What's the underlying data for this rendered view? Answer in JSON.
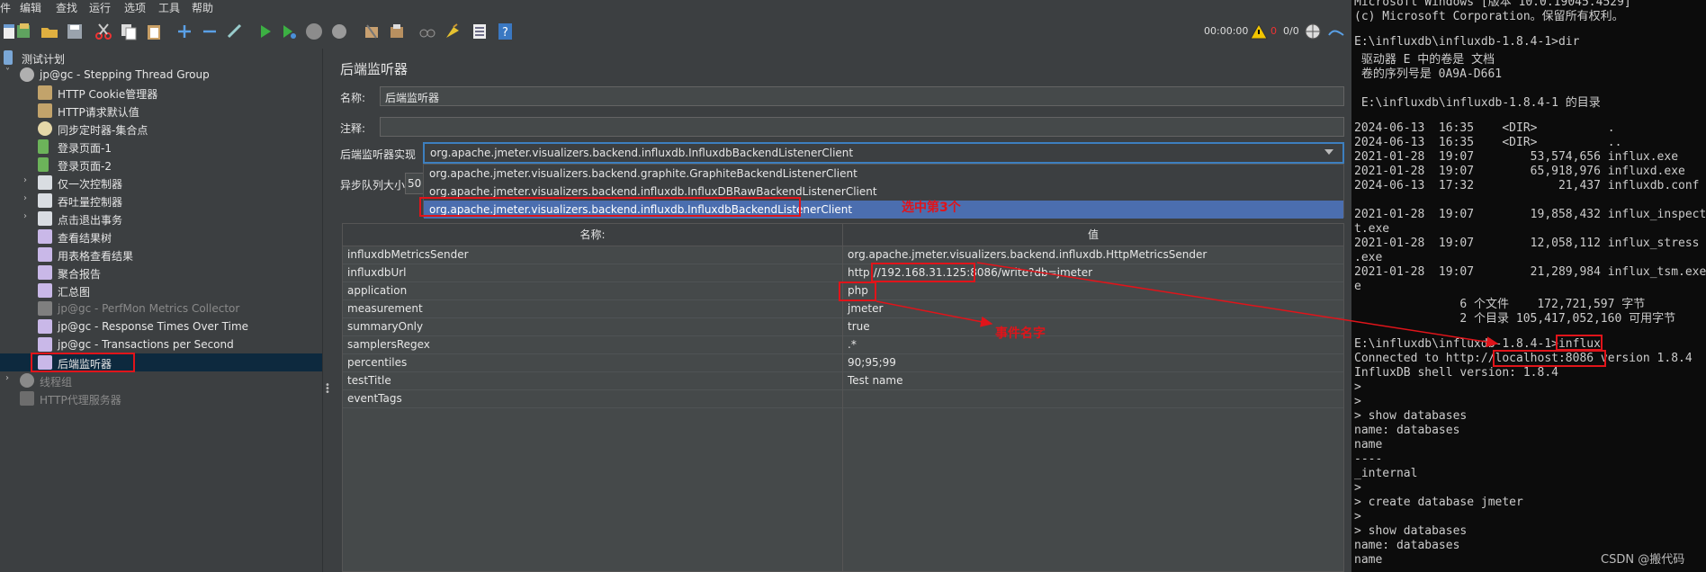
{
  "menu": [
    "件",
    "编辑",
    "查找",
    "运行",
    "选项",
    "工具",
    "帮助"
  ],
  "toolbar": {
    "timer": "00:00:00",
    "warning_count": "0",
    "threads": "0/0"
  },
  "tree": {
    "items": [
      {
        "label": "测试计划",
        "icon": "test-plan-icon"
      },
      {
        "label": "jp@gc - Stepping Thread Group",
        "icon": "gear-icon",
        "expander": "˅"
      },
      {
        "label": "HTTP Cookie管理器",
        "icon": "tools-icon"
      },
      {
        "label": "HTTP请求默认值",
        "icon": "tools-icon"
      },
      {
        "label": "同步定时器-集合点",
        "icon": "timer-icon"
      },
      {
        "label": "登录页面-1",
        "icon": "pipette-icon"
      },
      {
        "label": "登录页面-2",
        "icon": "pipette-icon"
      },
      {
        "label": "仅一次控制器",
        "icon": "controller-icon",
        "expander": "›"
      },
      {
        "label": "吞吐量控制器",
        "icon": "controller-icon",
        "expander": "›"
      },
      {
        "label": "点击退出事务",
        "icon": "controller-icon",
        "expander": "›"
      },
      {
        "label": "查看结果树",
        "icon": "listener-icon"
      },
      {
        "label": "用表格查看结果",
        "icon": "listener-icon"
      },
      {
        "label": "聚合报告",
        "icon": "listener-icon"
      },
      {
        "label": "汇总图",
        "icon": "listener-icon"
      },
      {
        "label": "jp@gc - PerfMon Metrics Collector",
        "icon": "listener-icon",
        "dim": true
      },
      {
        "label": "jp@gc - Response Times Over Time",
        "icon": "listener-icon"
      },
      {
        "label": "jp@gc - Transactions per Second",
        "icon": "listener-icon"
      },
      {
        "label": "后端监听器",
        "icon": "listener-icon",
        "selected": true
      },
      {
        "label": "线程组",
        "icon": "gear-icon",
        "dim": true,
        "expander": "›"
      },
      {
        "label": "HTTP代理服务器",
        "icon": "proxy-icon",
        "dim": true
      }
    ]
  },
  "panel": {
    "title": "后端监听器",
    "name_label": "名称:",
    "name_value": "后端监听器",
    "comment_label": "注释:",
    "comment_value": "",
    "impl_label": "后端监听器实现",
    "impl_value": "org.apache.jmeter.visualizers.backend.influxdb.InfluxdbBackendListenerClient",
    "options": [
      "org.apache.jmeter.visualizers.backend.graphite.GraphiteBackendListenerClient",
      "org.apache.jmeter.visualizers.backend.influxdb.InfluxDBRawBackendListenerClient",
      "org.apache.jmeter.visualizers.backend.influxdb.InfluxdbBackendListenerClient"
    ],
    "queue_label": "异步队列大小",
    "queue_value": "50",
    "table": {
      "col_name": "名称:",
      "col_value": "值",
      "rows": [
        {
          "name": "influxdbMetricsSender",
          "value": "org.apache.jmeter.visualizers.backend.influxdb.HttpMetricsSender"
        },
        {
          "name": "influxdbUrl",
          "value": "http://192.168.31.125:8086/write?db=jmeter"
        },
        {
          "name": "application",
          "value": "php"
        },
        {
          "name": "measurement",
          "value": "jmeter"
        },
        {
          "name": "summaryOnly",
          "value": "true"
        },
        {
          "name": "samplersRegex",
          "value": ".*"
        },
        {
          "name": "percentiles",
          "value": "90;95;99"
        },
        {
          "name": "testTitle",
          "value": "Test name"
        },
        {
          "name": "eventTags",
          "value": ""
        }
      ]
    }
  },
  "annotations": {
    "select_third": "选中第3个",
    "event_name": "事件名字"
  },
  "console": {
    "lines": [
      "Microsoft Windows [版本 10.0.19045.4529]",
      "(c) Microsoft Corporation。保留所有权利。",
      "",
      "E:\\influxdb\\influxdb-1.8.4-1>dir",
      " 驱动器 E 中的卷是 文档",
      " 卷的序列号是 0A9A-D661",
      "",
      " E:\\influxdb\\influxdb-1.8.4-1 的目录",
      "",
      "2024-06-13  16:35    <DIR>          .",
      "2024-06-13  16:35    <DIR>          ..",
      "2021-01-28  19:07        53,574,656 influx.exe",
      "2021-01-28  19:07        65,918,976 influxd.exe",
      "2024-06-13  17:32            21,437 influxdb.conf",
      "",
      "2021-01-28  19:07        19,858,432 influx_inspect",
      "t.exe",
      "2021-01-28  19:07        12,058,112 influx_stress",
      ".exe",
      "2021-01-28  19:07        21,289,984 influx_tsm.exe",
      "e",
      "               6 个文件    172,721,597 字节",
      "               2 个目录 105,417,052,160 可用字节",
      "",
      "E:\\influxdb\\influxdb-1.8.4-1>influx",
      "Connected to http://localhost:8086 version 1.8.4",
      "InfluxDB shell version: 1.8.4",
      ">",
      ">",
      "> show databases",
      "name: databases",
      "name",
      "----",
      "_internal",
      ">",
      "> create database jmeter",
      ">",
      "> show databases",
      "name: databases",
      "name"
    ]
  },
  "watermark": "CSDN @搬代码",
  "colors": {
    "accent": "#4b6eaf",
    "annotation": "#e0141a",
    "bg": "#3c3f41",
    "console_bg": "#0c0c0c"
  }
}
